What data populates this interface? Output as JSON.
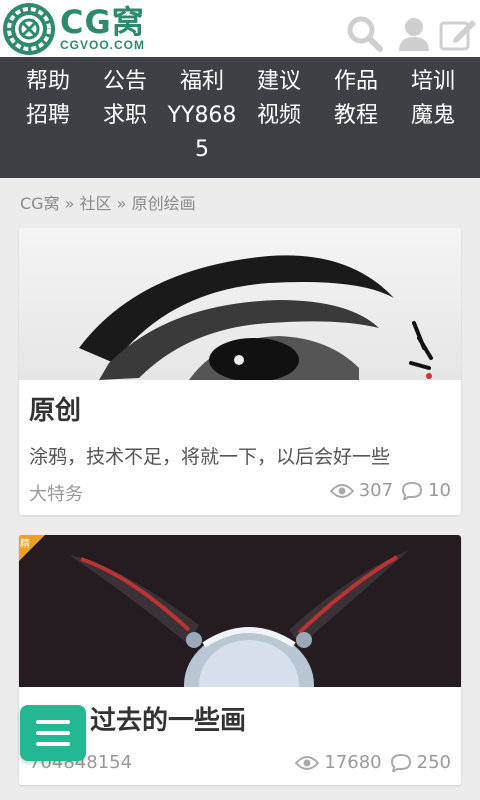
{
  "header": {
    "brand": "CG窝",
    "domain": "CGVOO.COM"
  },
  "nav": {
    "items": [
      {
        "label": "帮助"
      },
      {
        "label": "公告"
      },
      {
        "label": "福利"
      },
      {
        "label": "建议"
      },
      {
        "label": "作品"
      },
      {
        "label": "培训"
      },
      {
        "label": "招聘"
      },
      {
        "label": "求职"
      },
      {
        "label": "YY868"
      },
      {
        "label": "视频"
      },
      {
        "label": "教程"
      },
      {
        "label": "魔鬼"
      },
      {
        "label": "5"
      }
    ]
  },
  "breadcrumb": {
    "home": "CG窝",
    "sep": "»",
    "community": "社区",
    "current": "原创绘画"
  },
  "posts": [
    {
      "title": "原创",
      "excerpt": "涂鸦，技术不足，将就一下，以后会好一些",
      "author": "大特务",
      "views": "307",
      "comments": "10"
    },
    {
      "badge": "精",
      "title": "他人 过去的一些画",
      "author": "704848154",
      "views": "17680",
      "comments": "250"
    }
  ],
  "colors": {
    "brand": "#2d8a6e",
    "nav_bg": "#3f4045",
    "fab": "#23b792"
  }
}
